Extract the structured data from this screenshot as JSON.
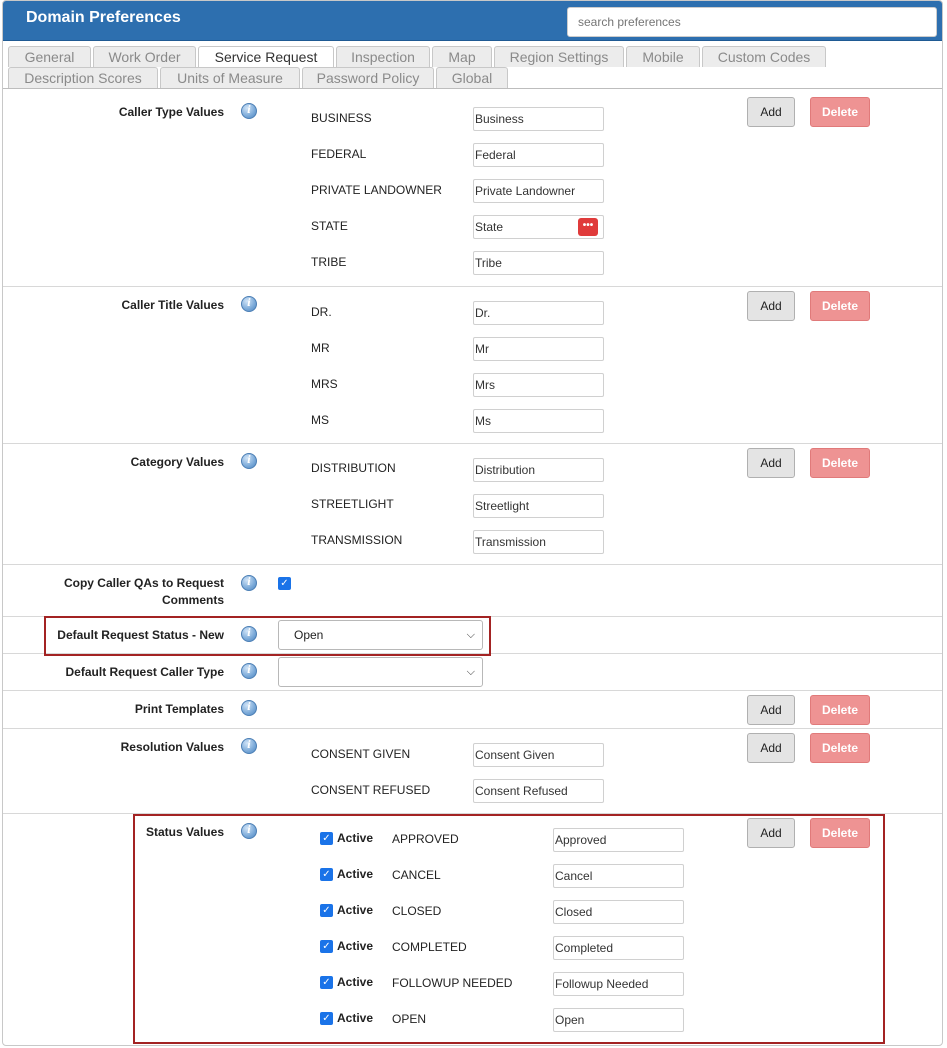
{
  "window": {
    "title": "Domain Preferences"
  },
  "search": {
    "placeholder": "search preferences"
  },
  "tabs": [
    "General",
    "Work Order",
    "Service Request",
    "Inspection",
    "Map",
    "Region Settings",
    "Mobile",
    "Custom Codes",
    "Description Scores",
    "Units of Measure",
    "Password Policy",
    "Global"
  ],
  "active_tab": "Service Request",
  "buttons": {
    "add": "Add",
    "delete": "Delete"
  },
  "sections": {
    "caller_type": {
      "label": "Caller Type Values",
      "items": [
        {
          "code": "BUSINESS",
          "value": "Business"
        },
        {
          "code": "FEDERAL",
          "value": "Federal"
        },
        {
          "code": "PRIVATE LANDOWNER",
          "value": "Private Landowner"
        },
        {
          "code": "STATE",
          "value": "State"
        },
        {
          "code": "TRIBE",
          "value": "Tribe"
        }
      ]
    },
    "caller_title": {
      "label": "Caller Title Values",
      "items": [
        {
          "code": "DR.",
          "value": "Dr."
        },
        {
          "code": "MR",
          "value": "Mr"
        },
        {
          "code": "MRS",
          "value": "Mrs"
        },
        {
          "code": "MS",
          "value": "Ms"
        }
      ]
    },
    "category": {
      "label": "Category Values",
      "items": [
        {
          "code": "DISTRIBUTION",
          "value": "Distribution"
        },
        {
          "code": "STREETLIGHT",
          "value": "Streetlight"
        },
        {
          "code": "TRANSMISSION",
          "value": "Transmission"
        }
      ]
    },
    "copy_caller": {
      "label_line1": "Copy Caller QAs to Request",
      "label_line2": "Comments",
      "checked": true
    },
    "default_status_new": {
      "label": "Default Request Status - New",
      "selected": "Open"
    },
    "default_caller_type": {
      "label": "Default Request Caller Type",
      "selected": ""
    },
    "print_templates": {
      "label": "Print Templates"
    },
    "resolution": {
      "label": "Resolution Values",
      "items": [
        {
          "code": "CONSENT GIVEN",
          "value": "Consent Given"
        },
        {
          "code": "CONSENT REFUSED",
          "value": "Consent Refused"
        }
      ]
    },
    "status": {
      "label": "Status Values",
      "active_label": "Active",
      "items": [
        {
          "code": "APPROVED",
          "value": "Approved",
          "active": true
        },
        {
          "code": "CANCEL",
          "value": "Cancel",
          "active": true
        },
        {
          "code": "CLOSED",
          "value": "Closed",
          "active": true
        },
        {
          "code": "COMPLETED",
          "value": "Completed",
          "active": true
        },
        {
          "code": "FOLLOWUP NEEDED",
          "value": "Followup Needed",
          "active": true
        },
        {
          "code": "OPEN",
          "value": "Open",
          "active": true
        }
      ]
    }
  },
  "colors": {
    "titlebar": "#2d6faf",
    "highlight": "#a32323",
    "delete": "#ee9393"
  }
}
